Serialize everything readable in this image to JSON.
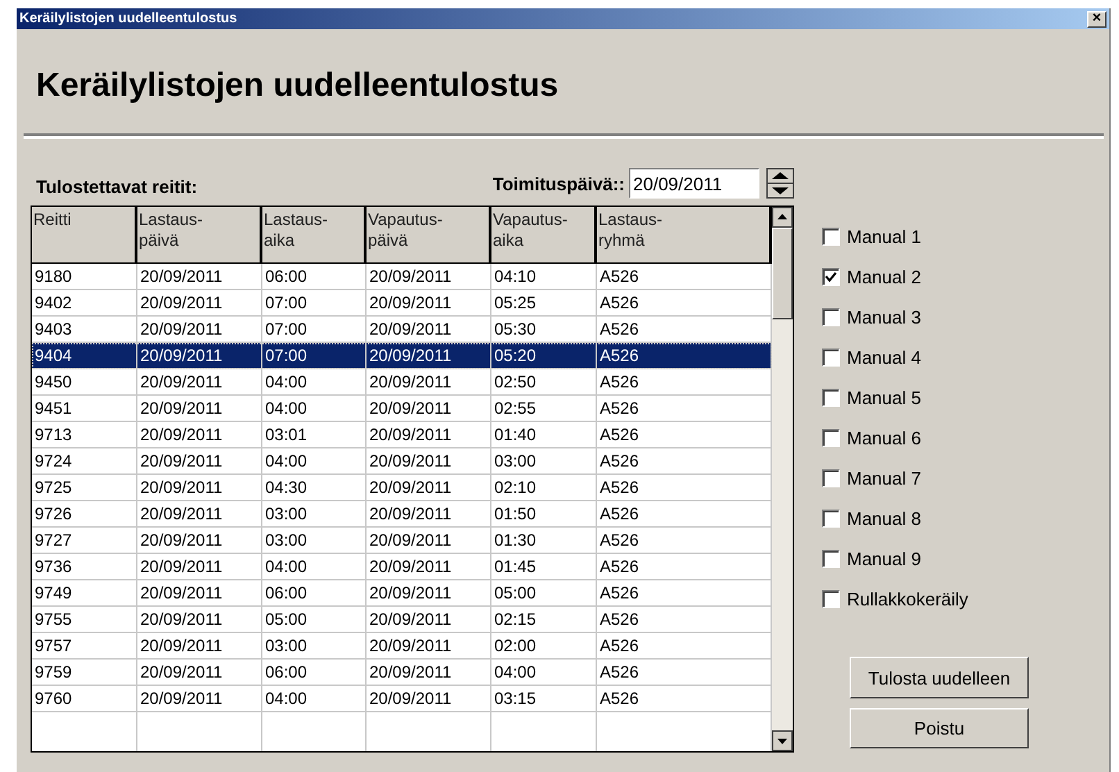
{
  "window": {
    "title": "Keräilylistojen uudelleentulostus",
    "close": "×"
  },
  "heading": "Keräilylistojen uudelleentulostus",
  "routes_label": "Tulostettavat reitit:",
  "delivery_date": {
    "label": "Toimituspäivä::",
    "value": "20/09/2011"
  },
  "table": {
    "columns": [
      "Reitti",
      "Lastaus-\npäivä",
      "Lastaus-\naika",
      "Vapautus-\npäivä",
      "Vapautus-\naika",
      "Lastaus-\nryhmä"
    ],
    "rows": [
      {
        "cells": [
          "9180",
          "20/09/2011",
          "06:00",
          "20/09/2011",
          "04:10",
          "A526"
        ],
        "selected": false
      },
      {
        "cells": [
          "9402",
          "20/09/2011",
          "07:00",
          "20/09/2011",
          "05:25",
          "A526"
        ],
        "selected": false
      },
      {
        "cells": [
          "9403",
          "20/09/2011",
          "07:00",
          "20/09/2011",
          "05:30",
          "A526"
        ],
        "selected": false
      },
      {
        "cells": [
          "9404",
          "20/09/2011",
          "07:00",
          "20/09/2011",
          "05:20",
          "A526"
        ],
        "selected": true
      },
      {
        "cells": [
          "9450",
          "20/09/2011",
          "04:00",
          "20/09/2011",
          "02:50",
          "A526"
        ],
        "selected": false
      },
      {
        "cells": [
          "9451",
          "20/09/2011",
          "04:00",
          "20/09/2011",
          "02:55",
          "A526"
        ],
        "selected": false
      },
      {
        "cells": [
          "9713",
          "20/09/2011",
          "03:01",
          "20/09/2011",
          "01:40",
          "A526"
        ],
        "selected": false
      },
      {
        "cells": [
          "9724",
          "20/09/2011",
          "04:00",
          "20/09/2011",
          "03:00",
          "A526"
        ],
        "selected": false
      },
      {
        "cells": [
          "9725",
          "20/09/2011",
          "04:30",
          "20/09/2011",
          "02:10",
          "A526"
        ],
        "selected": false
      },
      {
        "cells": [
          "9726",
          "20/09/2011",
          "03:00",
          "20/09/2011",
          "01:50",
          "A526"
        ],
        "selected": false
      },
      {
        "cells": [
          "9727",
          "20/09/2011",
          "03:00",
          "20/09/2011",
          "01:30",
          "A526"
        ],
        "selected": false
      },
      {
        "cells": [
          "9736",
          "20/09/2011",
          "04:00",
          "20/09/2011",
          "01:45",
          "A526"
        ],
        "selected": false
      },
      {
        "cells": [
          "9749",
          "20/09/2011",
          "06:00",
          "20/09/2011",
          "05:00",
          "A526"
        ],
        "selected": false
      },
      {
        "cells": [
          "9755",
          "20/09/2011",
          "05:00",
          "20/09/2011",
          "02:15",
          "A526"
        ],
        "selected": false
      },
      {
        "cells": [
          "9757",
          "20/09/2011",
          "03:00",
          "20/09/2011",
          "02:00",
          "A526"
        ],
        "selected": false
      },
      {
        "cells": [
          "9759",
          "20/09/2011",
          "06:00",
          "20/09/2011",
          "04:00",
          "A526"
        ],
        "selected": false
      },
      {
        "cells": [
          "9760",
          "20/09/2011",
          "04:00",
          "20/09/2011",
          "03:15",
          "A526"
        ],
        "selected": false
      }
    ]
  },
  "options": [
    {
      "label": "Manual 1",
      "checked": false
    },
    {
      "label": "Manual 2",
      "checked": true
    },
    {
      "label": "Manual 3",
      "checked": false
    },
    {
      "label": "Manual 4",
      "checked": false
    },
    {
      "label": "Manual 5",
      "checked": false
    },
    {
      "label": "Manual 6",
      "checked": false
    },
    {
      "label": "Manual 7",
      "checked": false
    },
    {
      "label": "Manual 8",
      "checked": false
    },
    {
      "label": "Manual 9",
      "checked": false
    },
    {
      "label": "Rullakkokeräily",
      "checked": false
    }
  ],
  "buttons": [
    "Tulosta uudelleen",
    "Poistu"
  ]
}
